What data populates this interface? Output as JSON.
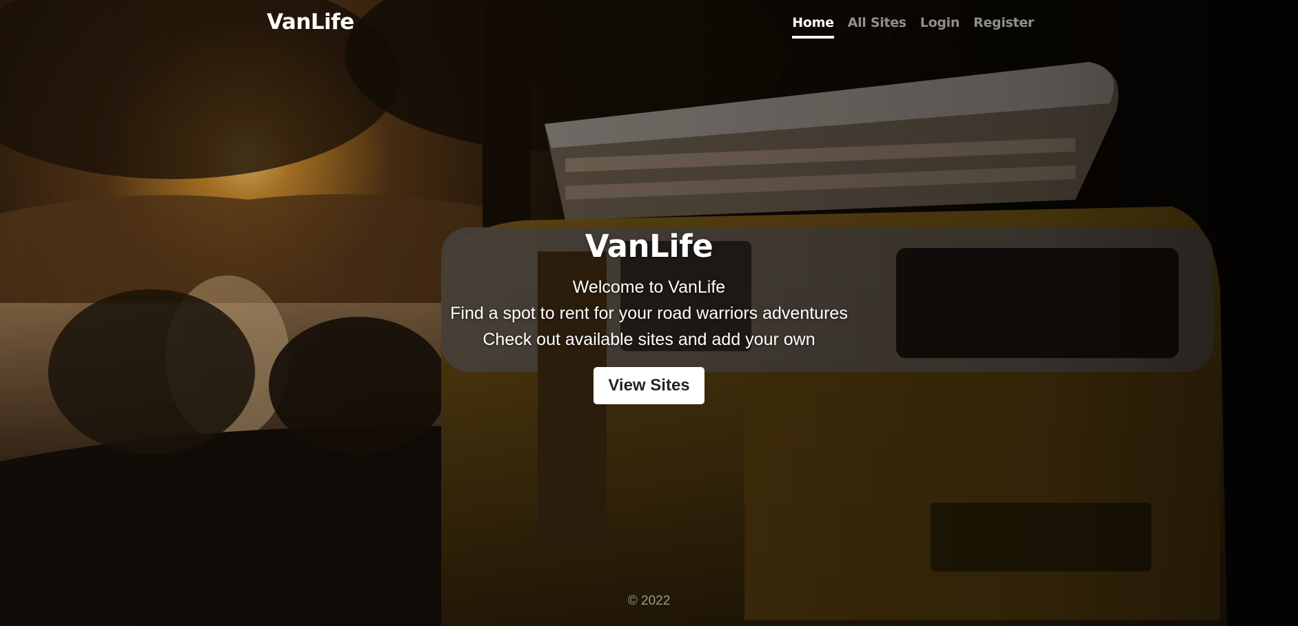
{
  "navbar": {
    "brand": "VanLife",
    "links": [
      {
        "label": "Home",
        "active": true
      },
      {
        "label": "All Sites",
        "active": false
      },
      {
        "label": "Login",
        "active": false
      },
      {
        "label": "Register",
        "active": false
      }
    ]
  },
  "hero": {
    "title": "VanLife",
    "lines": [
      "Welcome to VanLife",
      "Find a spot to rent for your road warriors adventures",
      "Check out available sites and add your own"
    ],
    "button_label": "View Sites",
    "background_image": "sunset-campervan-photo"
  },
  "footer": {
    "text": "© 2022"
  },
  "colors": {
    "nav_inactive": "#8c8c8c",
    "nav_active": "#ffffff",
    "button_bg": "#ffffff",
    "button_text": "#212529"
  }
}
